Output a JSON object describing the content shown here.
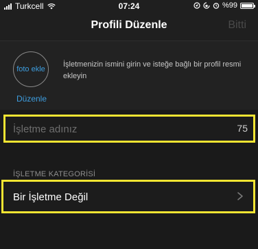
{
  "status_bar": {
    "carrier": "Turkcell",
    "time": "07:24",
    "battery_text": "%99",
    "battery_level": 0.99,
    "icons": [
      "signal-bars-icon",
      "wifi-icon",
      "location-icon",
      "lock-rotation-icon",
      "alarm-icon",
      "battery-icon"
    ]
  },
  "nav": {
    "title": "Profili Düzenle",
    "done_label": "Bitti"
  },
  "profile": {
    "photo_label": "foto ekle",
    "edit_label": "Düzenle",
    "hint": "İşletmenizin ismini girin ve isteğe bağlı bir profil resmi ekleyin"
  },
  "business_name": {
    "value": "",
    "placeholder": "İşletme adınız",
    "char_count": "75"
  },
  "category": {
    "header": "İŞLETME KATEGORİSİ",
    "value": "Bir İşletme Değil"
  },
  "colors": {
    "accent": "#3e9ee0",
    "highlight": "#f4e532",
    "background": "#1a1a1a"
  }
}
